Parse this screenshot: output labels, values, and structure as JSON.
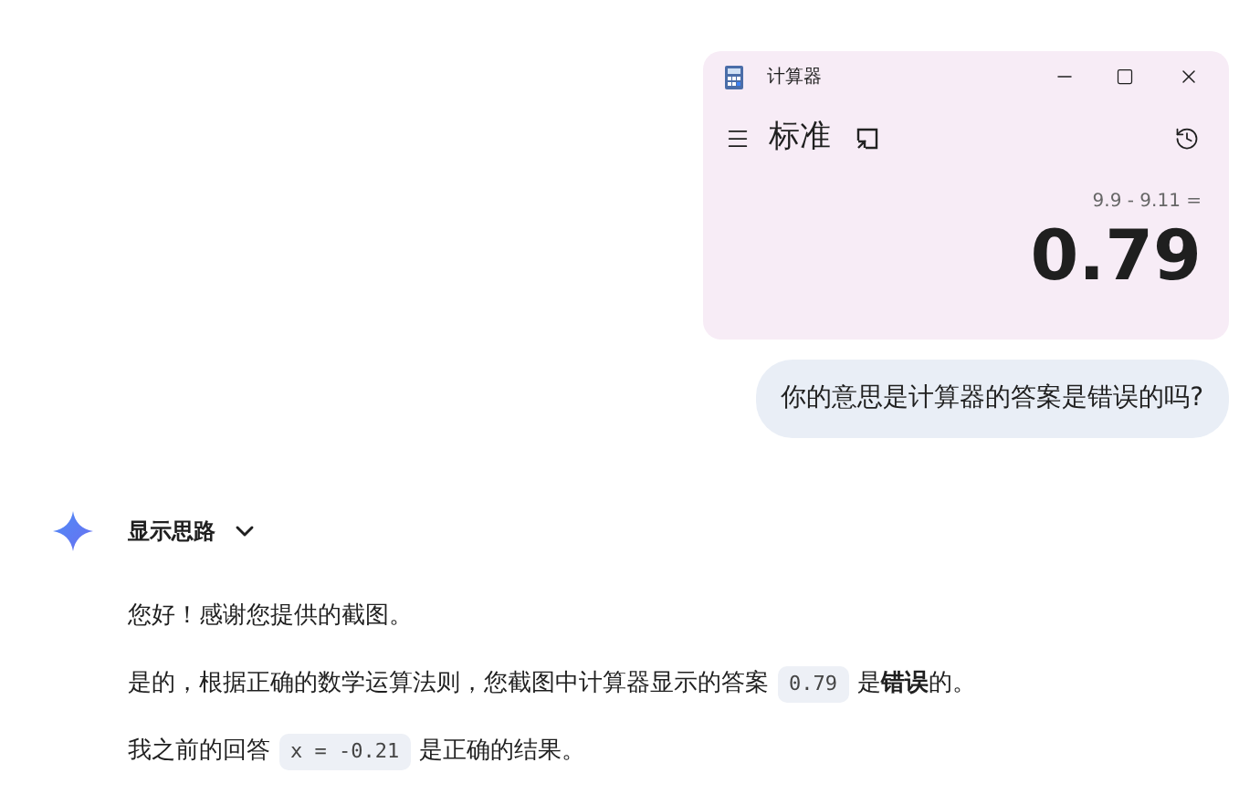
{
  "user_message": {
    "screenshot": {
      "window_title": "计算器",
      "mode": "标准",
      "expression": "9.9 - 9.11 =",
      "result": "0.79"
    },
    "text": "你的意思是计算器的答案是错误的吗?"
  },
  "response": {
    "thoughts_toggle": {
      "label": "显示思路",
      "expanded": false
    },
    "paragraphs": [
      [
        {
          "kind": "text",
          "text": "您好！感谢您提供的截图。"
        }
      ],
      [
        {
          "kind": "text",
          "text": "是的，根据正确的数学运算法则，您截图中计算器显示的答案"
        },
        {
          "kind": "code",
          "text": "0.79"
        },
        {
          "kind": "text",
          "text": "是**错误**的。"
        }
      ],
      [
        {
          "kind": "text",
          "text": "我之前的回答"
        },
        {
          "kind": "code",
          "text": "x = -0.21"
        },
        {
          "kind": "text",
          "text": "是正确的结果。"
        }
      ]
    ]
  }
}
